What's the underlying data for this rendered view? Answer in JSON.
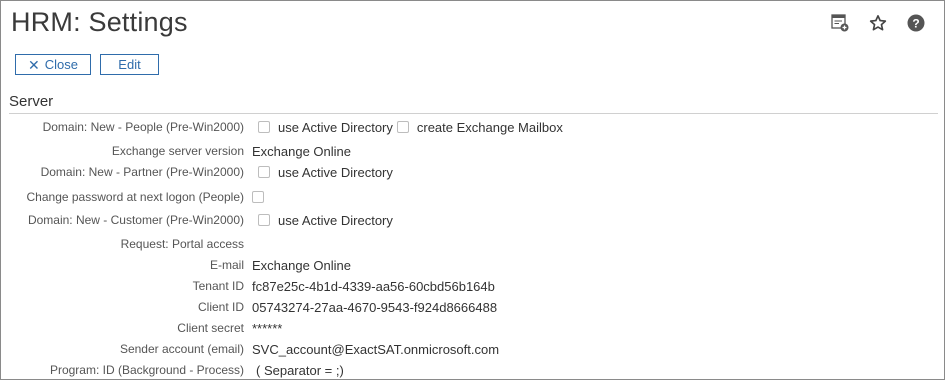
{
  "page": {
    "title": "HRM: Settings"
  },
  "toolbar": {
    "close_label": "Close",
    "edit_label": "Edit"
  },
  "icons": [
    "add-widget-icon",
    "star-icon",
    "help-icon"
  ],
  "section": {
    "title": "Server"
  },
  "rows": [
    {
      "label": "Domain: New - People (Pre-Win2000)",
      "options": [
        "use Active Directory",
        "create Exchange Mailbox"
      ]
    },
    {
      "label": "Exchange server version",
      "value": "Exchange Online"
    },
    {
      "label": "Domain: New - Partner (Pre-Win2000)",
      "options": [
        "use Active Directory"
      ]
    },
    {
      "label": "Change password at next logon (People)"
    },
    {
      "label": "Domain: New - Customer (Pre-Win2000)",
      "options": [
        "use Active Directory"
      ]
    },
    {
      "label": "Request: Portal access",
      "value": ""
    },
    {
      "label": "E-mail",
      "value": "Exchange Online"
    },
    {
      "label": "Tenant ID",
      "value": "fc87e25c-4b1d-4339-aa56-60cbd56b164b"
    },
    {
      "label": "Client ID",
      "value": "05743274-27aa-4670-9543-f924d8666488"
    },
    {
      "label": "Client secret",
      "value": "******"
    },
    {
      "label": "Sender account (email)",
      "value": "SVC_account@ExactSAT.onmicrosoft.com"
    },
    {
      "label": "Program: ID (Background - Process)",
      "value": "( Separator = ;)"
    }
  ]
}
